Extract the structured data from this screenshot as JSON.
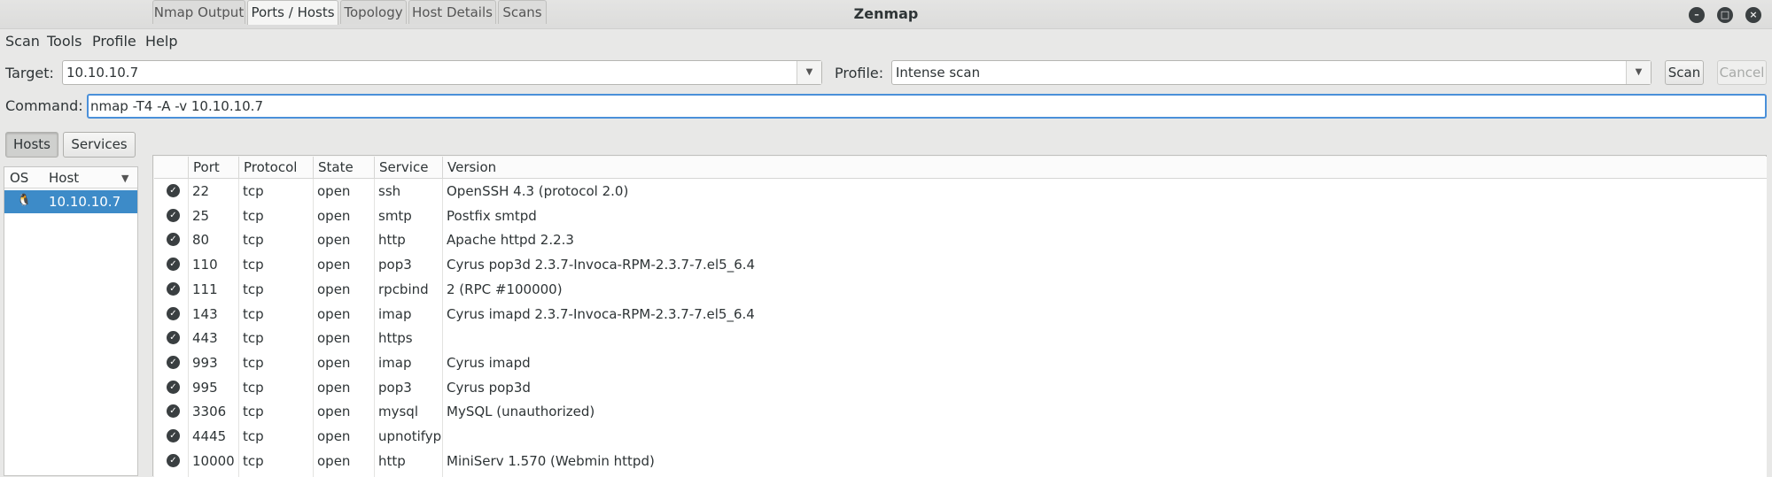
{
  "window": {
    "title": "Zenmap",
    "controls": {
      "minimize": "–",
      "maximize": "□",
      "close": "×"
    }
  },
  "menu": [
    "Scan",
    "Tools",
    "Profile",
    "Help"
  ],
  "toolbar": {
    "target_label": "Target:",
    "target_value": "10.10.10.7",
    "profile_label": "Profile:",
    "profile_value": "Intense scan",
    "scan_button": "Scan",
    "cancel_button": "Cancel",
    "command_label": "Command:",
    "command_value": "nmap -T4 -A -v 10.10.10.7"
  },
  "sidebar": {
    "hosts_toggle": "Hosts",
    "services_toggle": "Services",
    "columns": {
      "os": "OS",
      "host": "Host"
    },
    "hosts": [
      {
        "host": "10.10.10.7"
      }
    ]
  },
  "tabs": [
    "Nmap Output",
    "Ports / Hosts",
    "Topology",
    "Host Details",
    "Scans"
  ],
  "ports_table": {
    "columns": [
      "Port",
      "Protocol",
      "State",
      "Service",
      "Version"
    ],
    "rows": [
      {
        "port": "22",
        "protocol": "tcp",
        "state": "open",
        "service": "ssh",
        "version": "OpenSSH 4.3 (protocol 2.0)"
      },
      {
        "port": "25",
        "protocol": "tcp",
        "state": "open",
        "service": "smtp",
        "version": "Postfix smtpd"
      },
      {
        "port": "80",
        "protocol": "tcp",
        "state": "open",
        "service": "http",
        "version": "Apache httpd 2.2.3"
      },
      {
        "port": "110",
        "protocol": "tcp",
        "state": "open",
        "service": "pop3",
        "version": "Cyrus pop3d 2.3.7-Invoca-RPM-2.3.7-7.el5_6.4"
      },
      {
        "port": "111",
        "protocol": "tcp",
        "state": "open",
        "service": "rpcbind",
        "version": "2 (RPC #100000)"
      },
      {
        "port": "143",
        "protocol": "tcp",
        "state": "open",
        "service": "imap",
        "version": "Cyrus imapd 2.3.7-Invoca-RPM-2.3.7-7.el5_6.4"
      },
      {
        "port": "443",
        "protocol": "tcp",
        "state": "open",
        "service": "https",
        "version": ""
      },
      {
        "port": "993",
        "protocol": "tcp",
        "state": "open",
        "service": "imap",
        "version": "Cyrus imapd"
      },
      {
        "port": "995",
        "protocol": "tcp",
        "state": "open",
        "service": "pop3",
        "version": "Cyrus pop3d"
      },
      {
        "port": "3306",
        "protocol": "tcp",
        "state": "open",
        "service": "mysql",
        "version": "MySQL (unauthorized)"
      },
      {
        "port": "4445",
        "protocol": "tcp",
        "state": "open",
        "service": "upnotifyp",
        "version": ""
      },
      {
        "port": "10000",
        "protocol": "tcp",
        "state": "open",
        "service": "http",
        "version": "MiniServ 1.570 (Webmin httpd)"
      }
    ]
  },
  "icons": {
    "row_status": "check-circle-icon",
    "os": "linux-penguin-icon",
    "dropdown": "chevron-down-icon"
  },
  "colors": {
    "selection": "#3d8bc8",
    "focus_border": "#4a90d9"
  }
}
